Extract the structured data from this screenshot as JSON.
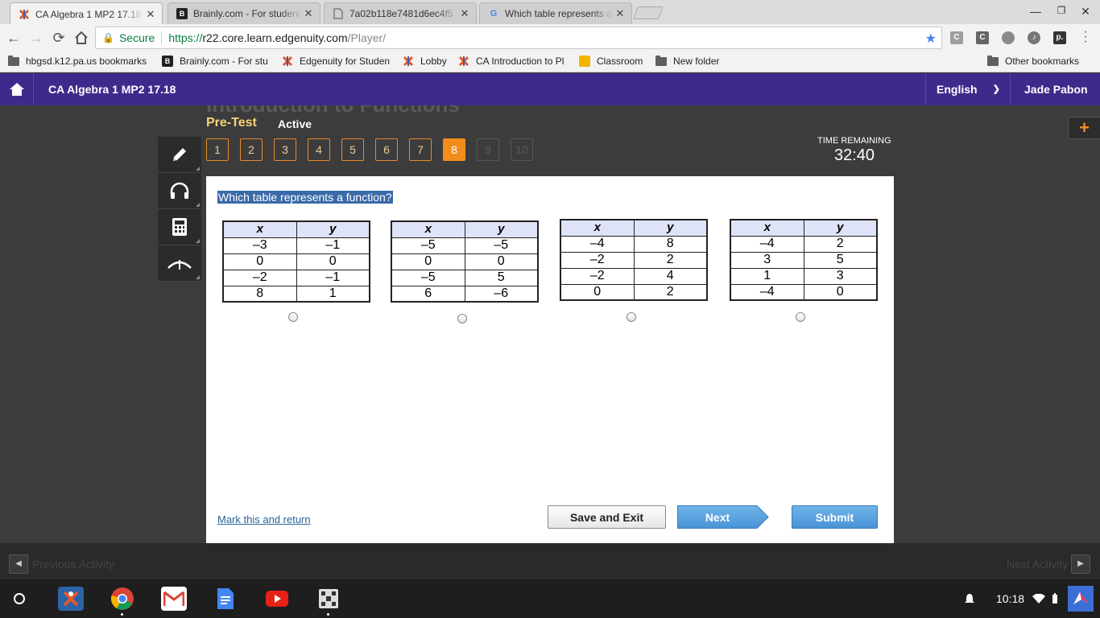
{
  "browser": {
    "tabs": [
      {
        "title": "CA Algebra 1 MP2 17.18",
        "icon": "edgenuity-icon",
        "active": true
      },
      {
        "title": "Brainly.com - For students",
        "icon": "brainly-icon",
        "active": false
      },
      {
        "title": "7a02b118e7481d6ec4f5",
        "icon": "document-icon",
        "active": false
      },
      {
        "title": "Which table represents a function",
        "icon": "google-icon",
        "active": false
      }
    ],
    "omnibox": {
      "secure_label": "Secure",
      "url_scheme": "https://",
      "url_host": "r22.core.learn.edgenuity.com",
      "url_path": "/Player/"
    },
    "extensions": [
      "C",
      "C",
      "",
      "",
      "p."
    ],
    "bookmarks": [
      {
        "label": "hbgsd.k12.pa.us bookmarks",
        "icon": "folder-icon"
      },
      {
        "label": "Brainly.com - For stu",
        "icon": "brainly-icon"
      },
      {
        "label": "Edgenuity for Studen",
        "icon": "edgenuity-icon"
      },
      {
        "label": "Lobby",
        "icon": "edgenuity-icon"
      },
      {
        "label": "CA Introduction to Pl",
        "icon": "edgenuity-icon"
      },
      {
        "label": "Classroom",
        "icon": "classroom-icon"
      },
      {
        "label": "New folder",
        "icon": "folder-icon"
      }
    ],
    "other_bookmarks": "Other bookmarks"
  },
  "header": {
    "course_title": "CA Algebra 1 MP2 17.18",
    "language": "English",
    "user_name": "Jade Pabon"
  },
  "player": {
    "ghost_title": "Introduction to Functions",
    "activity_type": "Pre-Test",
    "status": "Active",
    "questions": [
      {
        "label": "1",
        "state": "answered"
      },
      {
        "label": "2",
        "state": "answered"
      },
      {
        "label": "3",
        "state": "answered"
      },
      {
        "label": "4",
        "state": "answered"
      },
      {
        "label": "5",
        "state": "answered"
      },
      {
        "label": "6",
        "state": "answered"
      },
      {
        "label": "7",
        "state": "answered"
      },
      {
        "label": "8",
        "state": "current"
      },
      {
        "label": "9",
        "state": "disabled"
      },
      {
        "label": "10",
        "state": "disabled"
      }
    ],
    "time_label": "TIME REMAINING",
    "time_value": "32:40",
    "tools": [
      "pencil-icon",
      "headphones-icon",
      "calculator-icon",
      "reference-icon"
    ],
    "add_label": "+"
  },
  "question": {
    "prompt": "Which table represents a function?",
    "tables": [
      {
        "headers": [
          "x",
          "y"
        ],
        "rows": [
          [
            "–3",
            "–1"
          ],
          [
            "0",
            "0"
          ],
          [
            "–2",
            "–1"
          ],
          [
            "8",
            "1"
          ]
        ]
      },
      {
        "headers": [
          "x",
          "y"
        ],
        "rows": [
          [
            "–5",
            "–5"
          ],
          [
            "0",
            "0"
          ],
          [
            "–5",
            "5"
          ],
          [
            "6",
            "–6"
          ]
        ]
      },
      {
        "headers": [
          "x",
          "y"
        ],
        "rows": [
          [
            "–4",
            "8"
          ],
          [
            "–2",
            "2"
          ],
          [
            "–2",
            "4"
          ],
          [
            "0",
            "2"
          ]
        ]
      },
      {
        "headers": [
          "x",
          "y"
        ],
        "rows": [
          [
            "–4",
            "2"
          ],
          [
            "3",
            "5"
          ],
          [
            "1",
            "3"
          ],
          [
            "–4",
            "0"
          ]
        ]
      }
    ]
  },
  "footer": {
    "mark_return": "Mark this and return",
    "save_exit": "Save and Exit",
    "next": "Next",
    "submit": "Submit"
  },
  "activity_nav": {
    "previous": "Previous Activity",
    "next": "Next Activity"
  },
  "shelf": {
    "apps": [
      "edgenuity-app-icon",
      "chrome-app-icon",
      "gmail-app-icon",
      "docs-app-icon",
      "youtube-app-icon",
      "files-app-icon"
    ],
    "clock": "10:18"
  },
  "colors": {
    "header_purple": "#3f2a8c",
    "current_question": "#f28c1c",
    "button_blue": "#4a93d6",
    "table_header": "#dfe3f7"
  }
}
